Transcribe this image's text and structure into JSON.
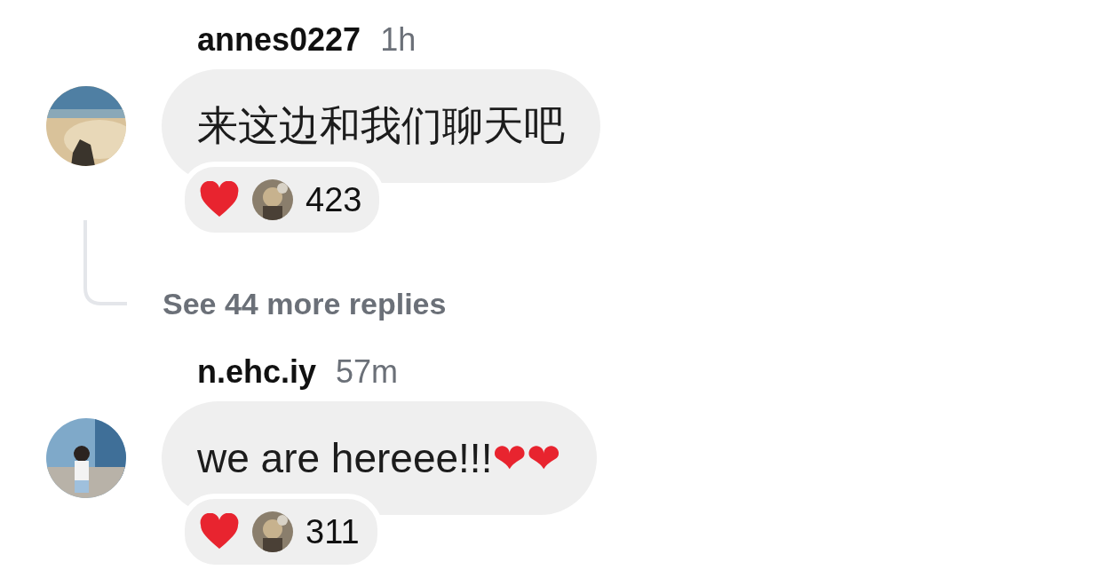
{
  "comments": [
    {
      "username": "annes0227",
      "time": "1h",
      "text": "来这边和我们聊天吧",
      "reactions": {
        "count": "423"
      },
      "more_replies": "See 44 more replies"
    },
    {
      "username": "n.ehc.iy",
      "time": "57m",
      "text": "we are hereee!!!",
      "trailing_emoji": "❤❤",
      "reactions": {
        "count": "311"
      }
    }
  ]
}
